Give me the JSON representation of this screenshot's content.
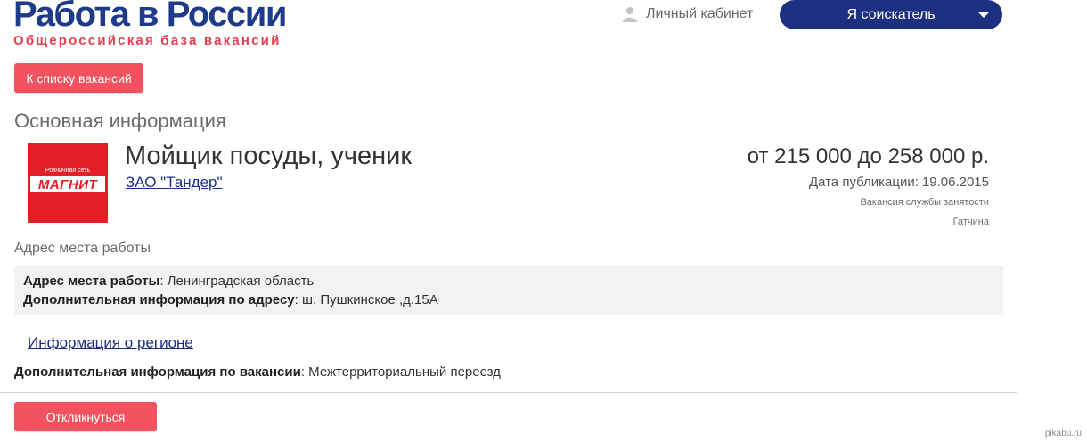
{
  "header": {
    "logo_title": "Работа в России",
    "logo_subtitle": "Общероссийская база вакансий",
    "cabinet_label": "Личный кабинет",
    "role_select_value": "Я соискатель"
  },
  "actions": {
    "back_label": "К списку вакансий",
    "respond_label": "Откликнуться"
  },
  "main": {
    "section_title": "Основная информация",
    "company_logo_text_top": "Розничная сеть",
    "company_logo_text_main": "МАГНИТ",
    "job_title": "Мойщик посуды, ученик",
    "company_name": "ЗАО \"Тандер\"",
    "salary": "от 215 000 до 258 000 р.",
    "publication_label": "Дата публикации:",
    "publication_date": "19.06.2015",
    "source": "Вакансия службы занятости",
    "city": "Гатчина"
  },
  "address": {
    "heading": "Адрес места работы",
    "work_address_label": "Адрес места работы",
    "work_address_value": ": Ленинградская область",
    "extra_address_label": "Дополнительная информация по адресу",
    "extra_address_value": ": ш. Пушкинское ,д.15А"
  },
  "region_link": "Информация о регионе",
  "vacancy_extra": {
    "label": "Дополнительная информация по вакансии",
    "value": ": Межтерриториальный переезд"
  },
  "watermark": "pikabu.ru",
  "colors": {
    "brand_blue": "#1d2f80",
    "accent_red": "#f2525f",
    "logo_red": "#e31e24"
  },
  "icons": {
    "cabinet": "user-icon",
    "role_select": "caret-down-icon"
  }
}
